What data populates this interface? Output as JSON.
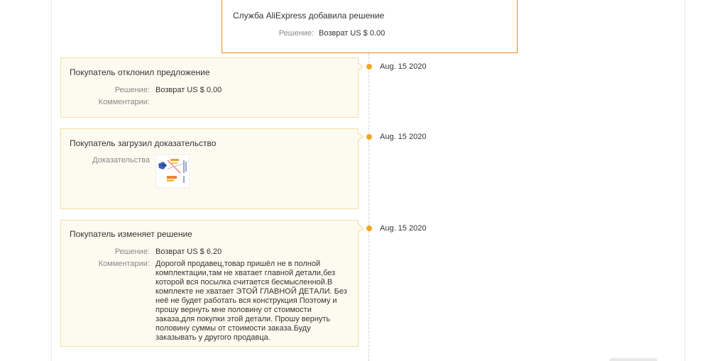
{
  "colors": {
    "accent": "#f5a623",
    "card_border": "#f5dfa8",
    "card_background": "#fdfbf0",
    "highlight_border": "#ee8a1e"
  },
  "service_entry": {
    "title": "Служба AliExpress добавила решение",
    "decision_label": "Решение:",
    "decision_value": "Возврат US $ 0.00"
  },
  "events": [
    {
      "title": "Покупатель отклонил предложение",
      "date": "Aug. 15 2020",
      "decision_label": "Решение:",
      "decision_value": "Возврат US $ 0.00",
      "comments_label": "Комментарии:",
      "comments_value": ""
    },
    {
      "title": "Покупатель загрузил доказательство",
      "date": "Aug. 15 2020",
      "evidence_label": "Доказательства",
      "evidence_icon": "image-thumbnail"
    },
    {
      "title": "Покупатель изменяет решение",
      "date": "Aug. 15 2020",
      "decision_label": "Решение:",
      "decision_value": "Возврат US $ 6.20",
      "comments_label": "Комментарии:",
      "comments_value": "Дорогой продавец,товар пришёл не в полной комплектации,там не хватает главной детали,без которой вся посылка считается бесмысленной.В комплекте не хватает ЭТОЙ ГЛАВНОЙ ДЕТАЛИ. Без неё не будет работать вся конструкция Поэтому и прошу вернуть мне половину от стоимости заказа,для покупки этой детали. Прошу вернуть половину суммы от стоимости заказа.Буду заказывать у другого продавца."
    }
  ]
}
